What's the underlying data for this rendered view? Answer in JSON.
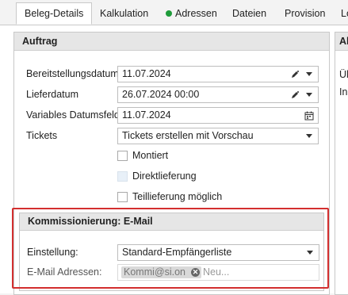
{
  "tabs": [
    {
      "label": "Beleg-Details",
      "active": true
    },
    {
      "label": "Kalkulation"
    },
    {
      "label": "Adressen",
      "status_color": "#1e9b3a"
    },
    {
      "label": "Dateien"
    },
    {
      "label": "Provision"
    },
    {
      "label": "Lo"
    }
  ],
  "auftrag": {
    "title": "Auftrag",
    "bereitstellungsdatum_label": "Bereitstellungsdatum",
    "bereitstellungsdatum_value": "11.07.2024",
    "lieferdatum_label": "Lieferdatum",
    "lieferdatum_value": "26.07.2024 00:00",
    "variables_label": "Variables Datumsfeld",
    "variables_value": "11.07.2024",
    "tickets_label": "Tickets",
    "tickets_value": "Tickets erstellen mit Vorschau",
    "checkboxes": [
      {
        "label": "Montiert",
        "checked": false,
        "enabled": true
      },
      {
        "label": "Direktlieferung",
        "checked": false,
        "enabled": false
      },
      {
        "label": "Teillieferung möglich",
        "checked": false,
        "enabled": true
      }
    ]
  },
  "right_panel": {
    "title": "Al",
    "line1": "Ül",
    "line2": "In"
  },
  "kommissionierung": {
    "title": "Kommissionierung: E-Mail",
    "einstellung_label": "Einstellung:",
    "einstellung_value": "Standard-Empfängerliste",
    "email_label": "E-Mail Adressen:",
    "email_chip": "Kommi@si.on",
    "email_placeholder": "Neu..."
  },
  "colors": {
    "highlight": "#d32f2f",
    "status_dot": "#1e9b3a"
  }
}
